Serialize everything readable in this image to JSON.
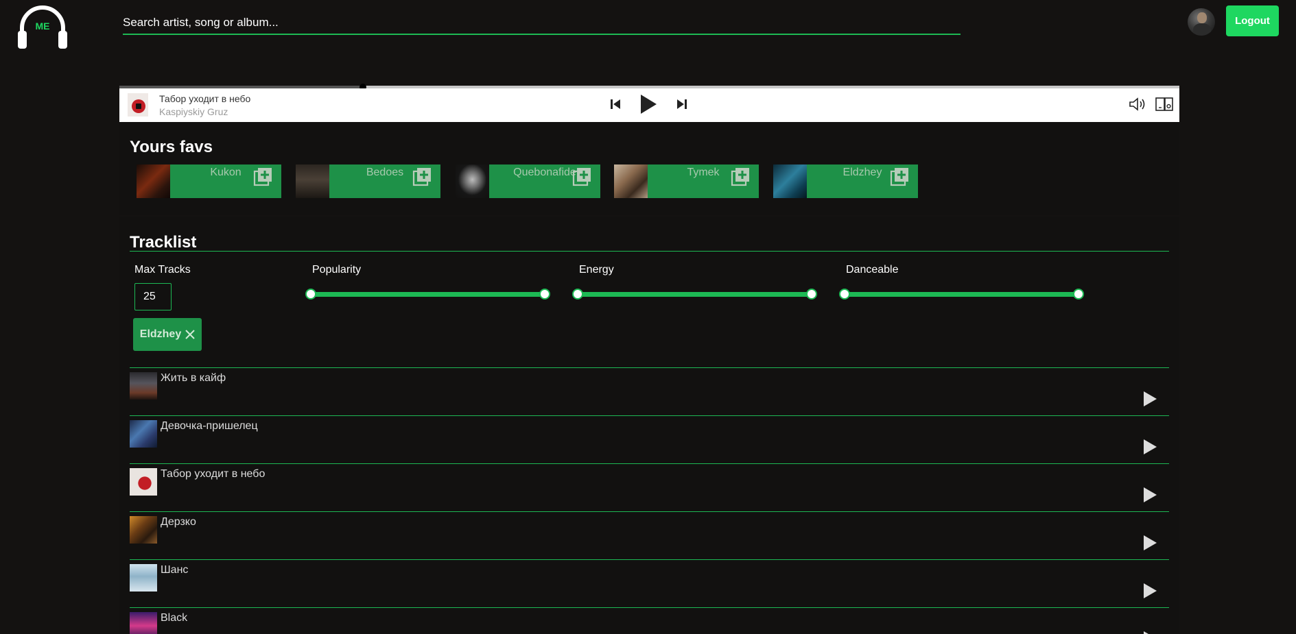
{
  "header": {
    "logo_text": "ME",
    "search_placeholder": "Search artist, song or album...",
    "logout_label": "Logout"
  },
  "player": {
    "title": "Табор уходит в небо",
    "artist": "Kaspiyskiy Gruz",
    "progress": 0.23
  },
  "favs": {
    "title": "Yours favs",
    "items": [
      {
        "name": "Kukon"
      },
      {
        "name": "Bedoes"
      },
      {
        "name": "Quebonafide"
      },
      {
        "name": "Tymek"
      },
      {
        "name": "Eldzhey"
      }
    ]
  },
  "tracklist": {
    "title": "Tracklist",
    "max_tracks_label": "Max Tracks",
    "max_tracks_value": "25",
    "filters": [
      {
        "label": "Popularity",
        "min": 0,
        "max": 100
      },
      {
        "label": "Energy",
        "min": 0,
        "max": 100
      },
      {
        "label": "Danceable",
        "min": 0,
        "max": 100
      }
    ],
    "selected_chip": "Eldzhey",
    "tracks": [
      {
        "name": "Жить в кайф"
      },
      {
        "name": "Девочка-пришелец"
      },
      {
        "name": "Табор уходит в небо"
      },
      {
        "name": "Дерзко"
      },
      {
        "name": "Шанс"
      },
      {
        "name": "Black"
      }
    ]
  },
  "colors": {
    "accent": "#1db954",
    "card_green": "#1e9148",
    "background": "#141211"
  }
}
